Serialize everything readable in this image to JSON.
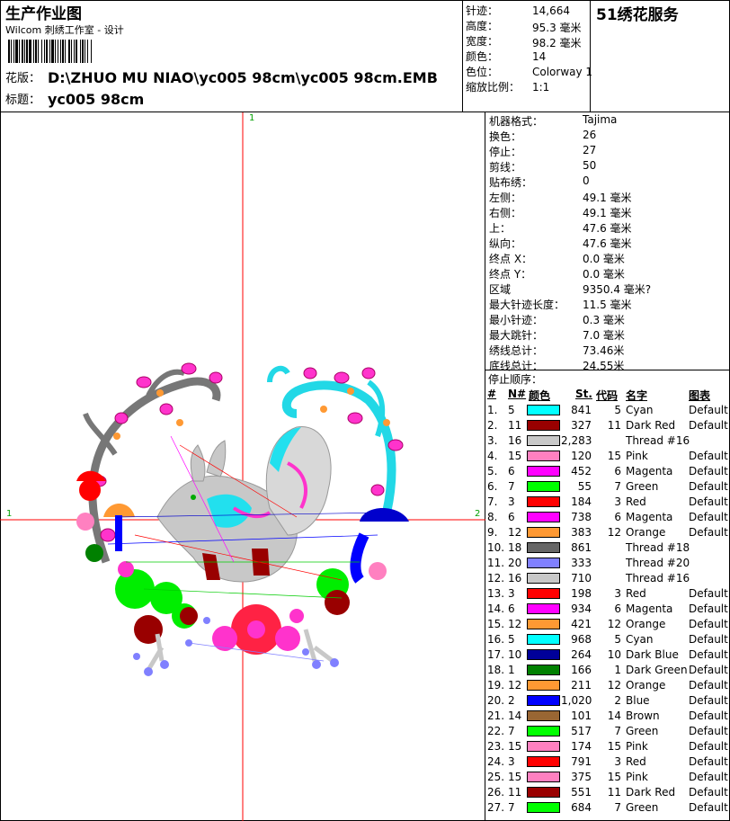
{
  "header": {
    "title": "生产作业图",
    "studio": "Wilcom 刺绣工作室 - 设计",
    "design_label": "花版：",
    "design_path": "D:\\ZHUO MU NIAO\\yc005 98cm\\yc005 98cm.EMB",
    "caption_label": "标题：",
    "caption": "yc005 98cm",
    "brand": "51绣花服务"
  },
  "summary": [
    {
      "label": "针迹：",
      "value": "14,664"
    },
    {
      "label": "高度：",
      "value": "95.3 毫米"
    },
    {
      "label": "宽度：",
      "value": "98.2 毫米"
    },
    {
      "label": "颜色：",
      "value": "14"
    },
    {
      "label": "色位：",
      "value": "Colorway 1"
    },
    {
      "label": "缩放比例：",
      "value": "1:1"
    }
  ],
  "stats": [
    {
      "label": "机器格式：",
      "value": "Tajima"
    },
    {
      "label": "换色：",
      "value": "26"
    },
    {
      "label": "停止：",
      "value": "27"
    },
    {
      "label": "剪线：",
      "value": "50"
    },
    {
      "label": "贴布绣：",
      "value": "0"
    },
    {
      "label": "左侧：",
      "value": "49.1 毫米"
    },
    {
      "label": "右侧：",
      "value": "49.1 毫米"
    },
    {
      "label": "上：",
      "value": "47.6 毫米"
    },
    {
      "label": "纵向：",
      "value": "47.6 毫米"
    },
    {
      "label": "终点 X：",
      "value": "0.0 毫米"
    },
    {
      "label": "终点 Y：",
      "value": "0.0 毫米"
    },
    {
      "label": "区域",
      "value": "9350.4 毫米?"
    },
    {
      "label": "最大针迹长度：",
      "value": "11.5 毫米"
    },
    {
      "label": "最小针迹：",
      "value": "0.3 毫米"
    },
    {
      "label": "最大跳针：",
      "value": "7.0 毫米"
    },
    {
      "label": "绣线总计：",
      "value": "73.46米"
    },
    {
      "label": "底线总计：",
      "value": "24.55米"
    }
  ],
  "stop_sequence": {
    "title": "停止顺序：",
    "headers": {
      "no": "#",
      "n": "N#",
      "color": "颜色",
      "st": "St.",
      "code": "代码",
      "name": "名字",
      "chart": "图表"
    },
    "rows": [
      {
        "no": "1.",
        "n": "5",
        "color": "#00ffff",
        "st": "841",
        "code": "5",
        "name": "Cyan",
        "chart": "Default"
      },
      {
        "no": "2.",
        "n": "11",
        "color": "#990000",
        "st": "327",
        "code": "11",
        "name": "Dark Red",
        "chart": "Default"
      },
      {
        "no": "3.",
        "n": "16",
        "color": "#c8c8c8",
        "st": "2,283",
        "code": "",
        "name": "Thread #16",
        "chart": ""
      },
      {
        "no": "4.",
        "n": "15",
        "color": "#ff80c0",
        "st": "120",
        "code": "15",
        "name": "Pink",
        "chart": "Default"
      },
      {
        "no": "5.",
        "n": "6",
        "color": "#ff00ff",
        "st": "452",
        "code": "6",
        "name": "Magenta",
        "chart": "Default"
      },
      {
        "no": "6.",
        "n": "7",
        "color": "#00ff00",
        "st": "55",
        "code": "7",
        "name": "Green",
        "chart": "Default"
      },
      {
        "no": "7.",
        "n": "3",
        "color": "#ff0000",
        "st": "184",
        "code": "3",
        "name": "Red",
        "chart": "Default"
      },
      {
        "no": "8.",
        "n": "6",
        "color": "#ff00ff",
        "st": "738",
        "code": "6",
        "name": "Magenta",
        "chart": "Default"
      },
      {
        "no": "9.",
        "n": "12",
        "color": "#ff9933",
        "st": "383",
        "code": "12",
        "name": "Orange",
        "chart": "Default"
      },
      {
        "no": "10.",
        "n": "18",
        "color": "#666666",
        "st": "861",
        "code": "",
        "name": "Thread #18",
        "chart": ""
      },
      {
        "no": "11.",
        "n": "20",
        "color": "#8080ff",
        "st": "333",
        "code": "",
        "name": "Thread #20",
        "chart": ""
      },
      {
        "no": "12.",
        "n": "16",
        "color": "#c8c8c8",
        "st": "710",
        "code": "",
        "name": "Thread #16",
        "chart": ""
      },
      {
        "no": "13.",
        "n": "3",
        "color": "#ff0000",
        "st": "198",
        "code": "3",
        "name": "Red",
        "chart": "Default"
      },
      {
        "no": "14.",
        "n": "6",
        "color": "#ff00ff",
        "st": "934",
        "code": "6",
        "name": "Magenta",
        "chart": "Default"
      },
      {
        "no": "15.",
        "n": "12",
        "color": "#ff9933",
        "st": "421",
        "code": "12",
        "name": "Orange",
        "chart": "Default"
      },
      {
        "no": "16.",
        "n": "5",
        "color": "#00ffff",
        "st": "968",
        "code": "5",
        "name": "Cyan",
        "chart": "Default"
      },
      {
        "no": "17.",
        "n": "10",
        "color": "#000099",
        "st": "264",
        "code": "10",
        "name": "Dark Blue",
        "chart": "Default"
      },
      {
        "no": "18.",
        "n": "1",
        "color": "#008000",
        "st": "166",
        "code": "1",
        "name": "Dark Green",
        "chart": "Default"
      },
      {
        "no": "19.",
        "n": "12",
        "color": "#ff9933",
        "st": "211",
        "code": "12",
        "name": "Orange",
        "chart": "Default"
      },
      {
        "no": "20.",
        "n": "2",
        "color": "#0000ff",
        "st": "1,020",
        "code": "2",
        "name": "Blue",
        "chart": "Default"
      },
      {
        "no": "21.",
        "n": "14",
        "color": "#996633",
        "st": "101",
        "code": "14",
        "name": "Brown",
        "chart": "Default"
      },
      {
        "no": "22.",
        "n": "7",
        "color": "#00ff00",
        "st": "517",
        "code": "7",
        "name": "Green",
        "chart": "Default"
      },
      {
        "no": "23.",
        "n": "15",
        "color": "#ff80c0",
        "st": "174",
        "code": "15",
        "name": "Pink",
        "chart": "Default"
      },
      {
        "no": "24.",
        "n": "3",
        "color": "#ff0000",
        "st": "791",
        "code": "3",
        "name": "Red",
        "chart": "Default"
      },
      {
        "no": "25.",
        "n": "15",
        "color": "#ff80c0",
        "st": "375",
        "code": "15",
        "name": "Pink",
        "chart": "Default"
      },
      {
        "no": "26.",
        "n": "11",
        "color": "#990000",
        "st": "551",
        "code": "11",
        "name": "Dark Red",
        "chart": "Default"
      },
      {
        "no": "27.",
        "n": "7",
        "color": "#00ff00",
        "st": "684",
        "code": "7",
        "name": "Green",
        "chart": "Default"
      }
    ]
  },
  "design_markers": {
    "top": "1",
    "left": "1",
    "right": "2"
  }
}
